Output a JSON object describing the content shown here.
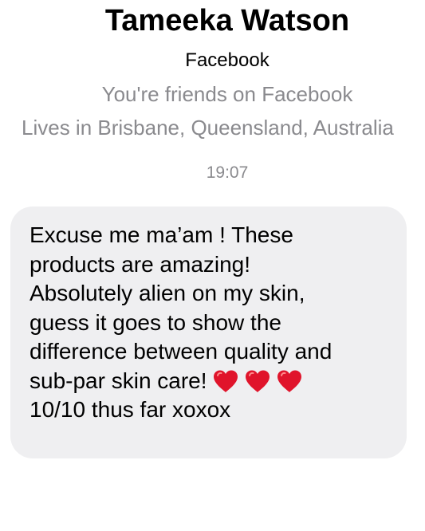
{
  "profile": {
    "name": "Tameeka Watson",
    "platform": "Facebook",
    "friendship": "You're friends on Facebook",
    "location": "Lives in Brisbane, Queensland, Australia"
  },
  "conversation": {
    "timestamp": "19:07",
    "message": {
      "text_before_emoji": "Excuse me ma’am ! These\nproducts are amazing!\nAbsolutely alien on my skin,\nguess it goes to show the\ndifference between quality and\nsub-par skin care!",
      "emoji": [
        "red-heart-icon",
        "red-heart-icon",
        "red-heart-icon"
      ],
      "text_after_emoji": "10/10 thus far xoxox"
    }
  },
  "colors": {
    "bubble_background": "#efeff1",
    "secondary_text": "#8a8a8e",
    "heart_red": "#e0142b"
  }
}
